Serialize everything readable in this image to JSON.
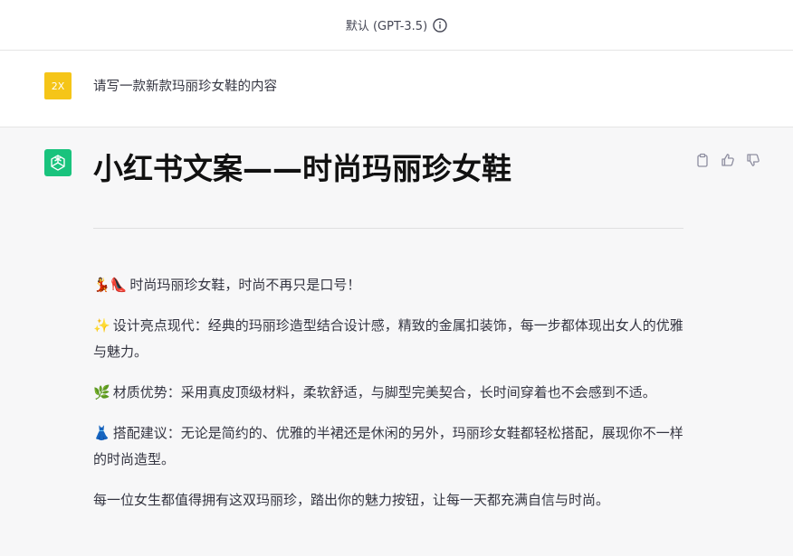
{
  "header": {
    "model_label": "默认 (GPT-3.5)"
  },
  "user_message": {
    "avatar_text": "2X",
    "text": "请写一款新款玛丽珍女鞋的内容"
  },
  "assistant_message": {
    "title": "小红书文案——时尚玛丽珍女鞋",
    "paragraphs": [
      {
        "emoji": "💃👠",
        "text": "时尚玛丽珍女鞋，时尚不再只是口号！"
      },
      {
        "emoji": "✨",
        "text": "设计亮点现代：经典的玛丽珍造型结合设计感，精致的金属扣装饰，每一步都体现出女人的优雅与魅力。"
      },
      {
        "emoji": "🌿",
        "text": "材质优势：采用真皮顶级材料，柔软舒适，与脚型完美契合，长时间穿着也不会感到不适。"
      },
      {
        "emoji": "👗",
        "text": "搭配建议：无论是简约的、优雅的半裙还是休闲的另外，玛丽珍女鞋都轻松搭配，展现你不一样的时尚造型。"
      },
      {
        "emoji": "",
        "text": "每一位女生都值得拥有这双玛丽珍，踏出你的魅力按钮，让每一天都充满自信与时尚。"
      }
    ]
  },
  "icons": {
    "info": "info-icon",
    "copy": "clipboard-icon",
    "like": "thumbs-up-icon",
    "dislike": "thumbs-down-icon",
    "bot_logo": "openai-logo-icon"
  },
  "colors": {
    "user_avatar_bg": "#f5c518",
    "bot_avatar_bg": "#19c37d",
    "bot_row_bg": "#f7f7f8"
  }
}
